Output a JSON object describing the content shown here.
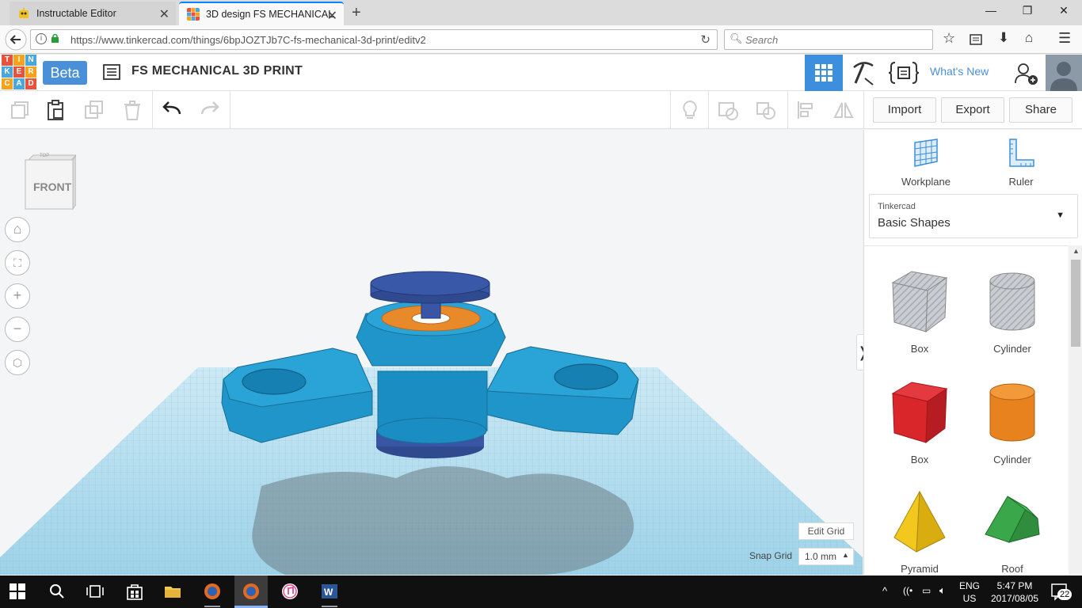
{
  "browser": {
    "tabs": [
      {
        "title": "Instructable Editor",
        "icon": "instructables-robot-icon",
        "active": false
      },
      {
        "title": "3D design FS MECHANICAL",
        "icon": "tinkercad-grid-icon",
        "active": true
      }
    ],
    "url": "https://www.tinkercad.com/things/6bpJOZTJb7C-fs-mechanical-3d-print/editv2",
    "search_placeholder": "Search",
    "accent_color": "#0a84ff"
  },
  "header": {
    "logo_letters": [
      "T",
      "I",
      "N",
      "K",
      "E",
      "R",
      "C",
      "A",
      "D"
    ],
    "logo_colors": [
      "#e8523a",
      "#f7a21b",
      "#48a7dd",
      "#e8523a",
      "#f7a21b",
      "#48a7dd",
      "#e8523a",
      "#f7a21b",
      "#48a7dd"
    ],
    "beta_label": "Beta",
    "design_title": "FS MECHANICAL 3D PRINT",
    "whats_new": "What's New",
    "brand_color": "#3b8fdc"
  },
  "toolbar": {
    "import_label": "Import",
    "export_label": "Export",
    "share_label": "Share"
  },
  "workspace": {
    "viewcube_face": "FRONT",
    "viewcube_top": "TOP",
    "edit_grid_label": "Edit Grid",
    "snap_grid_label": "Snap Grid",
    "snap_grid_value": "1.0 mm",
    "workplane_color": "#a8d8ec",
    "model_color": "#1f95c9",
    "cap_color": "#3856a5",
    "bearing_color": "#e98a2a"
  },
  "panel": {
    "workplane_label": "Workplane",
    "ruler_label": "Ruler",
    "category_small": "Tinkercad",
    "category": "Basic Shapes",
    "shapes": [
      {
        "label": "Box",
        "kind": "hole-box"
      },
      {
        "label": "Cylinder",
        "kind": "hole-cylinder"
      },
      {
        "label": "Box",
        "kind": "box",
        "color": "#d9262b"
      },
      {
        "label": "Cylinder",
        "kind": "cylinder",
        "color": "#e8821e"
      },
      {
        "label": "Pyramid",
        "kind": "pyramid",
        "color": "#f2c81e"
      },
      {
        "label": "Roof",
        "kind": "roof",
        "color": "#3aa84a"
      }
    ]
  },
  "taskbar": {
    "lang_top": "ENG",
    "lang_bottom": "US",
    "time": "5:47 PM",
    "date": "2017/08/05",
    "notifications": "22"
  }
}
